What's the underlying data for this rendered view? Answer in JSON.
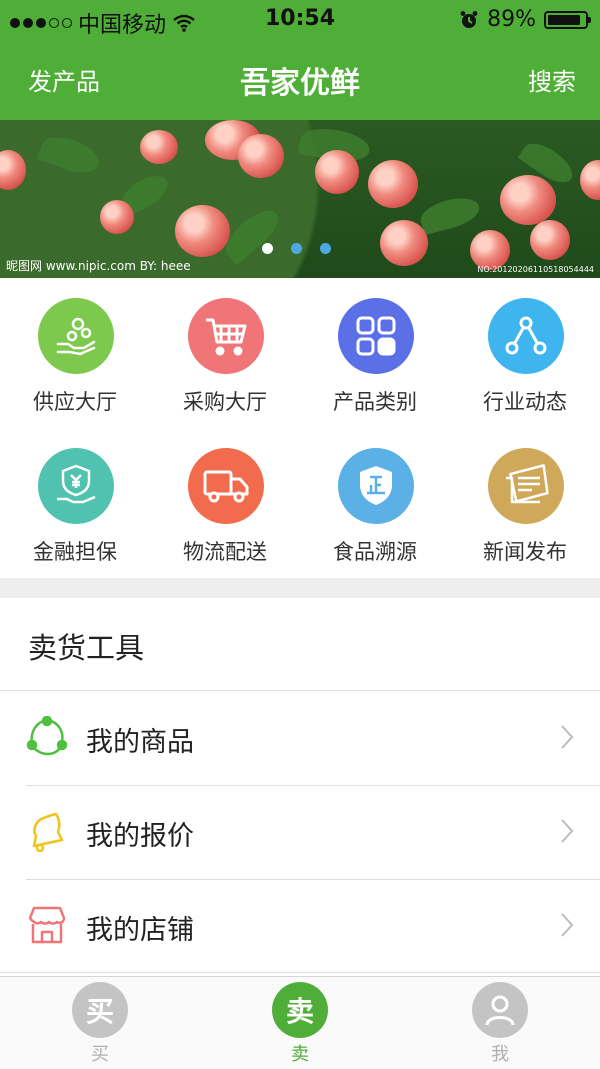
{
  "status": {
    "carrier": "中国移动",
    "time": "10:54",
    "battery": "89%",
    "battery_level": 0.89
  },
  "header": {
    "left": "发产品",
    "title": "吾家优鲜",
    "right": "搜索"
  },
  "banner": {
    "watermark": "昵图网 www.nipic.com   BY: heee",
    "code": "NO:20120206110518054444",
    "pages": 3,
    "active_page": 1
  },
  "grid": [
    {
      "label": "供应大厅",
      "icon": "hand-coins-icon",
      "color": "#7dc94e"
    },
    {
      "label": "采购大厅",
      "icon": "cart-icon",
      "color": "#f07576"
    },
    {
      "label": "产品类别",
      "icon": "grid-icon",
      "color": "#5b6fe6"
    },
    {
      "label": "行业动态",
      "icon": "share-nodes-icon",
      "color": "#3fb5f0"
    },
    {
      "label": "金融担保",
      "icon": "finance-shield-icon",
      "color": "#4fc3b0"
    },
    {
      "label": "物流配送",
      "icon": "truck-icon",
      "color": "#f26b4c"
    },
    {
      "label": "食品溯源",
      "icon": "certified-shield-icon",
      "color": "#5bb0e6"
    },
    {
      "label": "新闻发布",
      "icon": "newspaper-icon",
      "color": "#cfa85a"
    }
  ],
  "tools": {
    "title": "卖货工具",
    "items": [
      {
        "label": "我的商品",
        "icon": "nodes-icon",
        "color": "#4fbf3f"
      },
      {
        "label": "我的报价",
        "icon": "bell-icon",
        "color": "#f0c419"
      },
      {
        "label": "我的店铺",
        "icon": "store-icon",
        "color": "#f07576"
      }
    ]
  },
  "tabbar": [
    {
      "glyph": "买",
      "label": "买",
      "active": false
    },
    {
      "glyph": "卖",
      "label": "卖",
      "active": true
    },
    {
      "glyph": "",
      "label": "我",
      "active": false
    }
  ],
  "colors": {
    "brand": "#4fae37",
    "inactive": "#c4c4c4"
  }
}
